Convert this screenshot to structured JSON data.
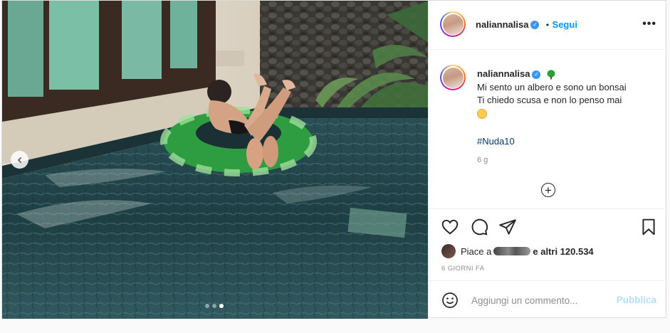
{
  "post": {
    "username": "naliannalisa",
    "separator": "•",
    "follow_label": "Segui",
    "more_label": "•••",
    "caption": {
      "lines": [
        "Mi sento un albero e sono un bonsai",
        "Ti chiedo scusa e non lo penso mai"
      ],
      "hashtag": "#Nuda10",
      "age": "6 g"
    },
    "carousel": {
      "current": 3,
      "total": 3
    },
    "likes": {
      "prefix": "Piace a",
      "redacted_user": "ela_ciofe",
      "suffix": "e altri 120.534"
    },
    "posted_time": "6 GIORNI FA",
    "comment": {
      "placeholder": "Aggiungi un commento...",
      "publish_label": "Pubblica"
    },
    "icons": {
      "verified": "verified-badge-icon",
      "tree": "tree-emoji-icon",
      "smile": "smiling-emoji-icon",
      "like": "heart-icon",
      "comment": "comment-bubble-icon",
      "share": "paper-plane-icon",
      "save": "bookmark-icon",
      "emoji_picker": "smiley-icon",
      "load_more": "plus-circle-icon",
      "prev": "chevron-left-icon"
    },
    "colors": {
      "accent": "#0095f6",
      "publish_disabled": "#b2dffc",
      "hashtag": "#00376b"
    }
  }
}
